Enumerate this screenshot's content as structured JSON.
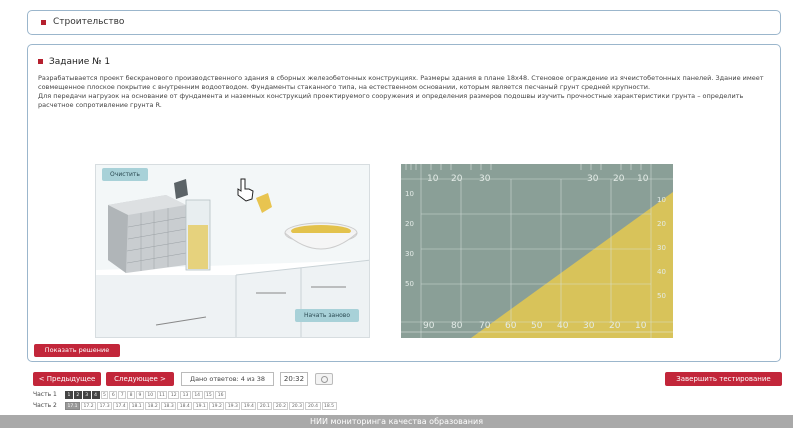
{
  "header": {
    "title": "Строительство"
  },
  "task": {
    "title": "Задание № 1",
    "paragraph1": "Разрабатывается проект бескранового производственного здания в сборных железобетонных конструкциях. Размеры здания в плане 18х48. Стеновое ограждение из ячеистобетонных панелей. Здание имеет совмещенное плоское покрытие с внутренним водоотводом. Фундаменты стаканного типа, на естественном основании, которым является песчаный грунт средней крупности.",
    "paragraph2": "Для передачи нагрузок на основание от фундамента и наземных конструкций проектируемого сооружения и определения размеров подошвы изучить прочностные характеристики грунта – определить расчетное сопротивление грунта R."
  },
  "scene": {
    "clear_label": "Очистить",
    "restart_label": "Начать заново"
  },
  "ruler": {
    "top_left_labels": [
      "10",
      "20",
      "30"
    ],
    "top_right_labels": [
      "30",
      "20",
      "10"
    ],
    "left_labels": [
      "10",
      "20",
      "30",
      "50"
    ],
    "right_labels": [
      "10",
      "20",
      "30",
      "40",
      "50"
    ],
    "bottom_labels": [
      "90",
      "80",
      "70",
      "60",
      "50",
      "40",
      "30",
      "20",
      "10"
    ]
  },
  "solution_label": "Показать решение",
  "nav": {
    "prev_label": "< Предыдущее",
    "next_label": "Следующее >",
    "answers_text": "Дано ответов: 4 из 38",
    "timer": "20:32",
    "finish_label": "Завершить тестирование"
  },
  "parts": [
    {
      "label": "Часть 1",
      "questions": [
        "1",
        "2",
        "3",
        "4",
        "5",
        "6",
        "7",
        "8",
        "9",
        "10",
        "11",
        "12",
        "13",
        "14",
        "15",
        "16"
      ],
      "answered": [
        "1",
        "2",
        "3",
        "4"
      ]
    },
    {
      "label": "Часть 2",
      "questions": [
        "17.1",
        "17.2",
        "17.3",
        "17.4",
        "18.1",
        "18.2",
        "18.3",
        "18.4",
        "19.1",
        "19.2",
        "19.3",
        "19.4",
        "20.1",
        "20.2",
        "20.3",
        "20.4",
        "18.5"
      ],
      "current": "17.1"
    }
  ],
  "footer": {
    "text": "НИИ мониторинга качества образования"
  },
  "colors": {
    "accent": "#c2263a",
    "panel_border": "#9bb6cc",
    "ruler_bg": "#8a9f97",
    "sand": "#d8c35a"
  }
}
